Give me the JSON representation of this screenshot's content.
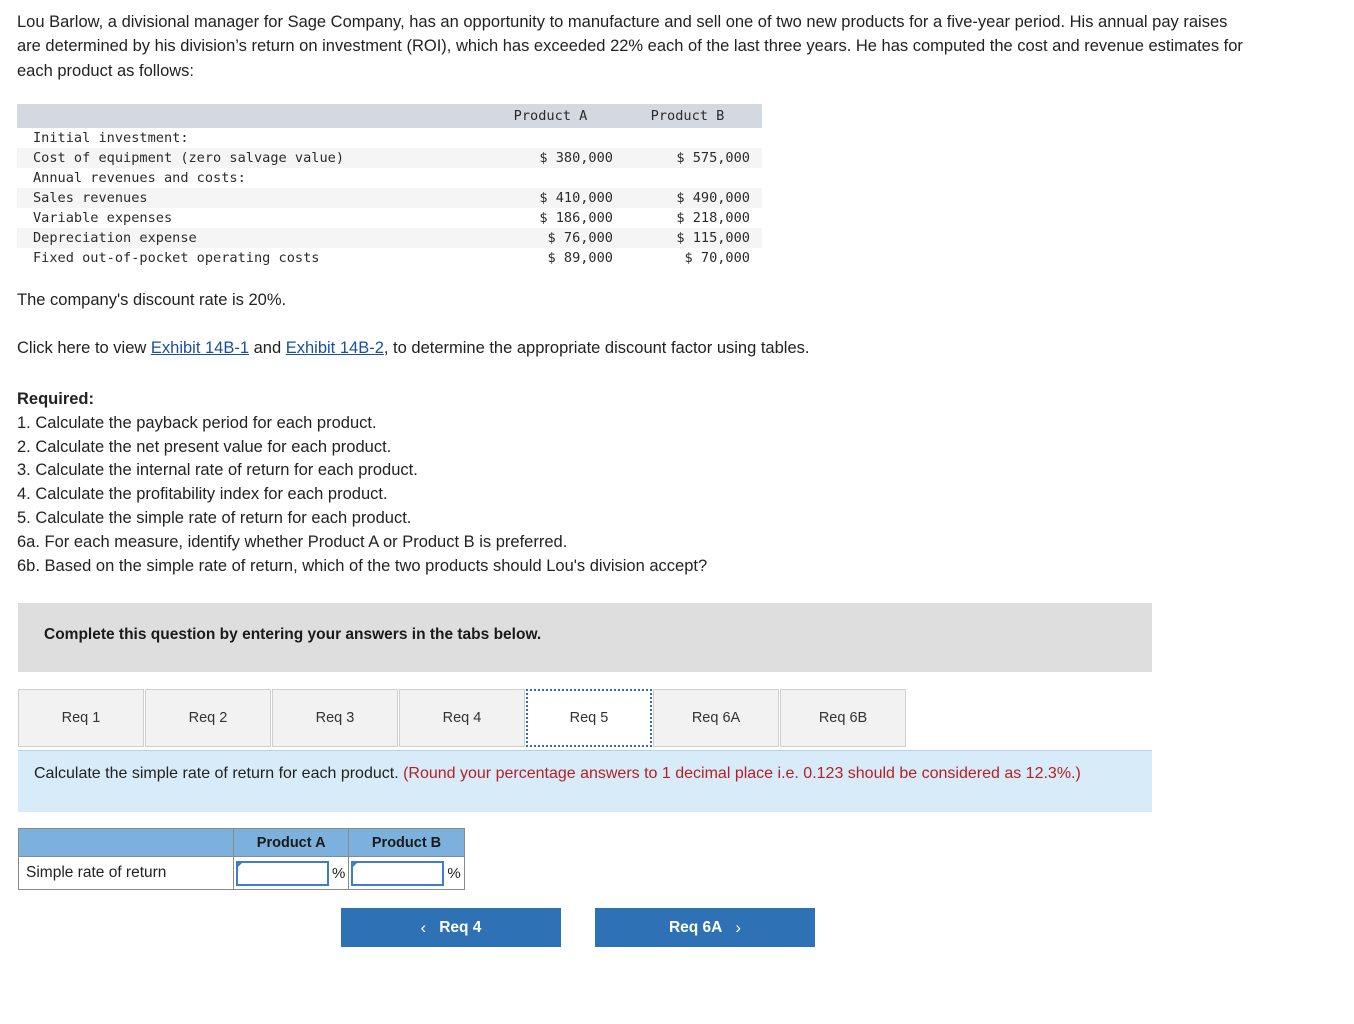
{
  "intro": {
    "paragraph": "Lou Barlow, a divisional manager for Sage Company, has an opportunity to manufacture and sell one of two new products for a five-year period. His annual pay raises are determined by his division’s return on investment (ROI), which has exceeded 22% each of the last three years. He has computed the cost and revenue estimates for each product as follows:"
  },
  "data_table": {
    "columns": [
      "",
      "Product A",
      "Product B"
    ],
    "rows": [
      {
        "label": "Initial investment:",
        "a": "",
        "b": "",
        "shaded": false
      },
      {
        "label": "Cost of equipment (zero salvage value)",
        "a": "$ 380,000",
        "b": "$ 575,000",
        "shaded": true
      },
      {
        "label": "Annual revenues and costs:",
        "a": "",
        "b": "",
        "shaded": false
      },
      {
        "label": "Sales revenues",
        "a": "$ 410,000",
        "b": "$ 490,000",
        "shaded": true
      },
      {
        "label": "Variable expenses",
        "a": "$ 186,000",
        "b": "$ 218,000",
        "shaded": false
      },
      {
        "label": "Depreciation expense",
        "a": "$ 76,000",
        "b": "$ 115,000",
        "shaded": true
      },
      {
        "label": "Fixed out-of-pocket operating costs",
        "a": "$ 89,000",
        "b": "$ 70,000",
        "shaded": false
      }
    ]
  },
  "discount_line": "The company's discount rate is 20%.",
  "exhibit_line": {
    "prefix": "Click here to view ",
    "link1": "Exhibit 14B-1",
    "middle": " and ",
    "link2": "Exhibit 14B-2",
    "suffix": ", to determine the appropriate discount factor using tables."
  },
  "required": {
    "title": "Required:",
    "items": [
      "1. Calculate the payback period for each product.",
      "2. Calculate the net present value for each product.",
      "3. Calculate the internal rate of return for each product.",
      "4. Calculate the profitability index for each product.",
      "5. Calculate the simple rate of return for each product.",
      "6a. For each measure, identify whether Product A or Product B is preferred.",
      "6b. Based on the simple rate of return, which of the two products should Lou's division accept?"
    ]
  },
  "banner": {
    "text": "Complete this question by entering your answers in the tabs below."
  },
  "tabs": {
    "items": [
      {
        "label": "Req 1",
        "active": false
      },
      {
        "label": "Req 2",
        "active": false
      },
      {
        "label": "Req 3",
        "active": false
      },
      {
        "label": "Req 4",
        "active": false
      },
      {
        "label": "Req 5",
        "active": true
      },
      {
        "label": "Req 6A",
        "active": false
      },
      {
        "label": "Req 6B",
        "active": false
      }
    ]
  },
  "instruction": {
    "black": "Calculate the simple rate of return for each product. ",
    "red": "(Round your percentage answers to 1 decimal place i.e. 0.123 should be considered as 12.3%.)"
  },
  "answer_table": {
    "corner": "",
    "col_a": "Product A",
    "col_b": "Product B",
    "row_label": "Simple rate of return",
    "value_a": "",
    "value_b": "",
    "unit": "%"
  },
  "nav": {
    "prev_label": "Req 4",
    "next_label": "Req 6A",
    "prev_icon": "‹",
    "next_icon": "›"
  },
  "colors": {
    "accent_blue": "#2f71b5",
    "table_header": "#d4d8e1",
    "answer_header": "#7cb0dd",
    "instruction_bg": "#d7ebf9",
    "banner_bg": "#dedede",
    "red_text": "#b52026",
    "link_blue": "#1a4f9c"
  }
}
